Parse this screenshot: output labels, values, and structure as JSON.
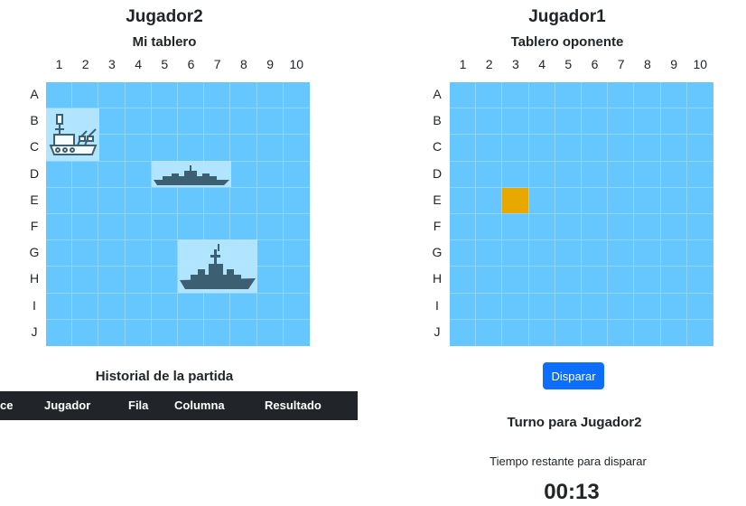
{
  "left_panel": {
    "player_name": "Jugador2",
    "board_title": "Mi tablero"
  },
  "right_panel": {
    "player_name": "Jugador1",
    "board_title": "Tablero oponente"
  },
  "columns": [
    "1",
    "2",
    "3",
    "4",
    "5",
    "6",
    "7",
    "8",
    "9",
    "10"
  ],
  "rows": [
    "A",
    "B",
    "C",
    "D",
    "E",
    "F",
    "G",
    "H",
    "I",
    "J"
  ],
  "my_board_ships": [
    {
      "name": "aircraft-carrier-ship-icon",
      "rows": "B-C",
      "cols": "1-2"
    },
    {
      "name": "destroyer-ship-icon",
      "rows": "D",
      "cols": "5-7"
    },
    {
      "name": "battleship-ship-icon",
      "rows": "G-H",
      "cols": "6-8"
    }
  ],
  "opponent_board_shots": [
    {
      "row": "E",
      "col": "3",
      "state": "selected",
      "color": "#e8a800"
    }
  ],
  "history": {
    "title": "Historial de la partida",
    "headers": [
      "ce",
      "Jugador",
      "Fila",
      "Columna",
      "Resultado"
    ]
  },
  "fire_button_label": "Disparar",
  "turn_text": "Turno para Jugador2",
  "time_label": "Tiempo restante para disparar",
  "timer_value": "00:13",
  "colors": {
    "water": "#66c7ff",
    "grid_line": "#8fd6ff",
    "ship_bg": "#b6e6ff",
    "ship_icon": "#3a5a6a",
    "button": "#0d6efd",
    "table_header": "#212529"
  }
}
